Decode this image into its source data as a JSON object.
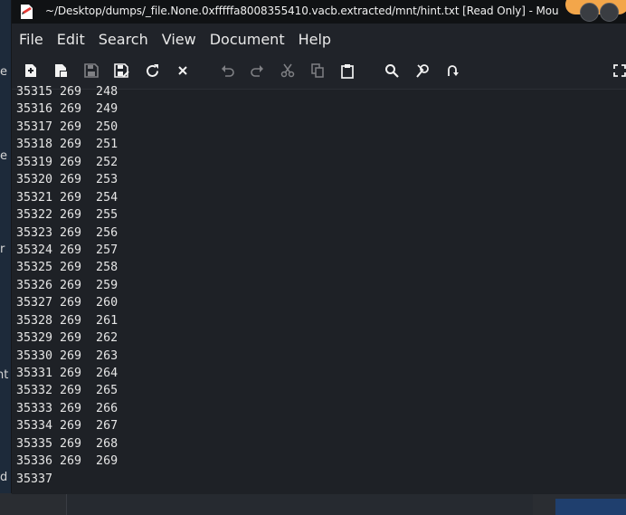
{
  "background": {
    "left_fragments": [
      "e",
      "e",
      "r",
      "nt",
      "d"
    ]
  },
  "window": {
    "title": "~/Desktop/dumps/_file.None.0xfffffa8008355410.vacb.extracted/mnt/hint.txt [Read Only] - Mou"
  },
  "menu": {
    "items": [
      "File",
      "Edit",
      "Search",
      "View",
      "Document",
      "Help"
    ]
  },
  "toolbar": {
    "buttons": [
      {
        "name": "new-file-icon",
        "icon": "new-document"
      },
      {
        "name": "new-window-icon",
        "icon": "new-window"
      },
      {
        "name": "save-icon",
        "icon": "floppy"
      },
      {
        "name": "save-as-icon",
        "icon": "floppy-edit"
      },
      {
        "name": "reload-icon",
        "icon": "reload"
      },
      {
        "name": "close-icon",
        "icon": "x"
      },
      {
        "name": "undo-icon",
        "icon": "undo"
      },
      {
        "name": "redo-icon",
        "icon": "redo"
      },
      {
        "name": "cut-icon",
        "icon": "scissors"
      },
      {
        "name": "copy-icon",
        "icon": "copy"
      },
      {
        "name": "paste-icon",
        "icon": "clipboard"
      },
      {
        "name": "find-icon",
        "icon": "magnifier"
      },
      {
        "name": "find-replace-icon",
        "icon": "magnifier-tools"
      },
      {
        "name": "go-to-line-icon",
        "icon": "go-to"
      },
      {
        "name": "fullscreen-icon",
        "icon": "fullscreen"
      }
    ]
  },
  "editor": {
    "lines": [
      "35315 269  248",
      "35316 269  249",
      "35317 269  250",
      "35318 269  251",
      "35319 269  252",
      "35320 269  253",
      "35321 269  254",
      "35322 269  255",
      "35323 269  256",
      "35324 269  257",
      "35325 269  258",
      "35326 269  259",
      "35327 269  260",
      "35328 269  261",
      "35329 269  262",
      "35330 269  263",
      "35331 269  264",
      "35332 269  265",
      "35333 269  266",
      "35334 269  267",
      "35335 269  268",
      "35336 269  269",
      "35337"
    ]
  },
  "colors": {
    "titlebar": "#101214",
    "editor_bg": "#1e2126",
    "text": "#e6e6e6",
    "accent_orange": "#f3a64a",
    "app_icon_red": "#e53935"
  }
}
